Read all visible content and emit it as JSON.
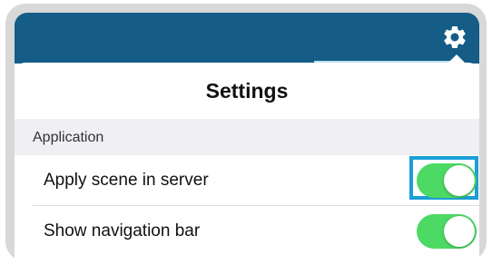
{
  "header": {
    "icon": "gear-icon",
    "bar_color": "#155d86"
  },
  "popover": {
    "title": "Settings"
  },
  "sections": [
    {
      "label": "Application",
      "rows": [
        {
          "label": "Apply scene in server",
          "toggle_on": true,
          "highlighted": true
        },
        {
          "label": "Show navigation bar",
          "toggle_on": true,
          "highlighted": false
        }
      ]
    }
  ],
  "colors": {
    "toggle_on": "#4cd964",
    "highlight": "#1a9fd6"
  }
}
